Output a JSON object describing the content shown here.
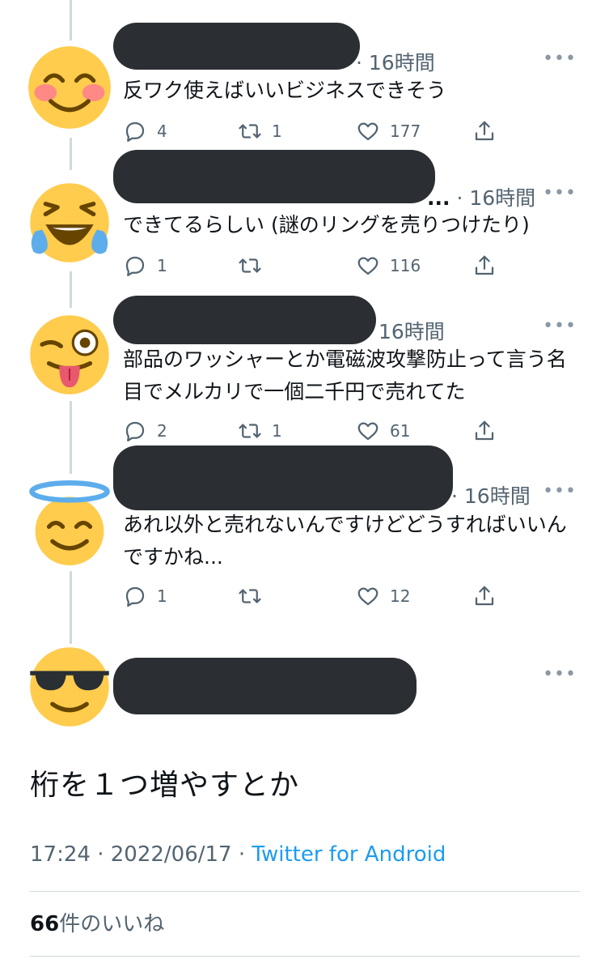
{
  "replies": [
    {
      "time": "16時間",
      "text": "反ワク使えばいいビジネスできそう",
      "reply_count": "4",
      "retweet_count": "1",
      "like_count": "177"
    },
    {
      "time": "16時間",
      "text": "できてるらしい (謎のリングを売りつけたり)",
      "reply_count": "1",
      "retweet_count": "",
      "like_count": "116"
    },
    {
      "time": "16時間",
      "text": "部品のワッシャーとか電磁波攻撃防止って言う名目でメルカリで一個二千円で売れてた",
      "reply_count": "2",
      "retweet_count": "1",
      "like_count": "61"
    },
    {
      "time": "16時間",
      "text": "あれ以外と売れないんですけどどうすればいいんですかね...",
      "reply_count": "1",
      "retweet_count": "",
      "like_count": "12"
    }
  ],
  "main_tweet": {
    "text": "桁を１つ増やすとか",
    "time": "17:24",
    "date": "2022/06/17",
    "via": "Twitter for Android",
    "likes_count": "66",
    "likes_label": "件のいいね"
  },
  "sep": " · ",
  "more_glyph": "•••",
  "ellipsis": "...",
  "icons": [
    "smiling-face-icon",
    "laughing-tears-icon",
    "winking-tongue-icon",
    "halo-face-icon",
    "sunglasses-face-icon",
    "reply-icon",
    "retweet-icon",
    "like-icon",
    "share-icon",
    "more-icon"
  ]
}
